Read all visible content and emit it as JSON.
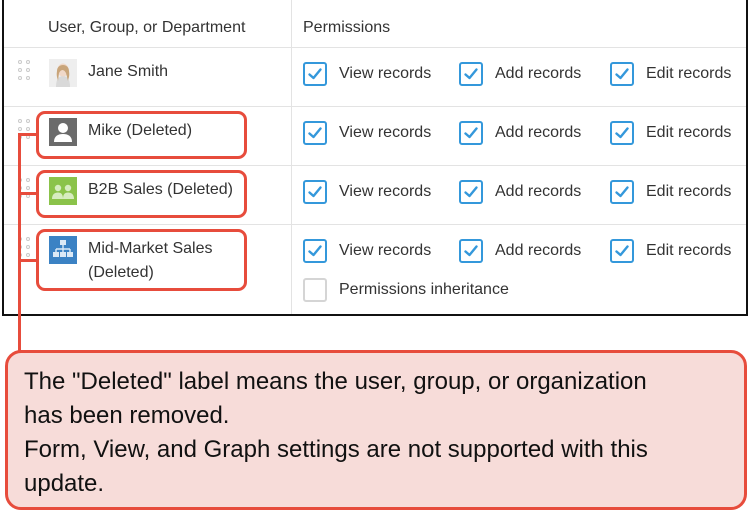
{
  "table": {
    "headers": {
      "entity": "User, Group, or Department",
      "permissions": "Permissions"
    },
    "rows": [
      {
        "name_line1": "Jane Smith",
        "name_line2": "",
        "avatar": "user-photo-avatar",
        "permissions": [
          {
            "label": "View records",
            "checked": true
          },
          {
            "label": "Add records",
            "checked": true
          },
          {
            "label": "Edit records",
            "checked": true
          }
        ]
      },
      {
        "name_line1": "Mike (Deleted)",
        "name_line2": "",
        "avatar": "deleted-user-avatar",
        "permissions": [
          {
            "label": "View records",
            "checked": true
          },
          {
            "label": "Add records",
            "checked": true
          },
          {
            "label": "Edit records",
            "checked": true
          }
        ]
      },
      {
        "name_line1": "B2B Sales (Deleted)",
        "name_line2": "",
        "avatar": "group-avatar",
        "permissions": [
          {
            "label": "View records",
            "checked": true
          },
          {
            "label": "Add records",
            "checked": true
          },
          {
            "label": "Edit records",
            "checked": true
          }
        ]
      },
      {
        "name_line1": "Mid-Market Sales",
        "name_line2": "(Deleted)",
        "avatar": "department-avatar",
        "permissions": [
          {
            "label": "View records",
            "checked": true
          },
          {
            "label": "Add records",
            "checked": true
          },
          {
            "label": "Edit records",
            "checked": true
          }
        ],
        "extra_permission": {
          "label": "Permissions inheritance",
          "checked": false
        }
      }
    ]
  },
  "callout": {
    "lines": [
      "The \"Deleted\" label means the user, group, or organization",
      "has been removed.",
      "Form, View, and Graph settings are not supported with this",
      "update."
    ]
  },
  "colors": {
    "checkbox_accent": "#3498db",
    "highlight_red": "#e74c3c",
    "callout_bg": "#f7dcd9",
    "group_avatar_green": "#8bc34a",
    "department_avatar_blue": "#3b82c4"
  }
}
